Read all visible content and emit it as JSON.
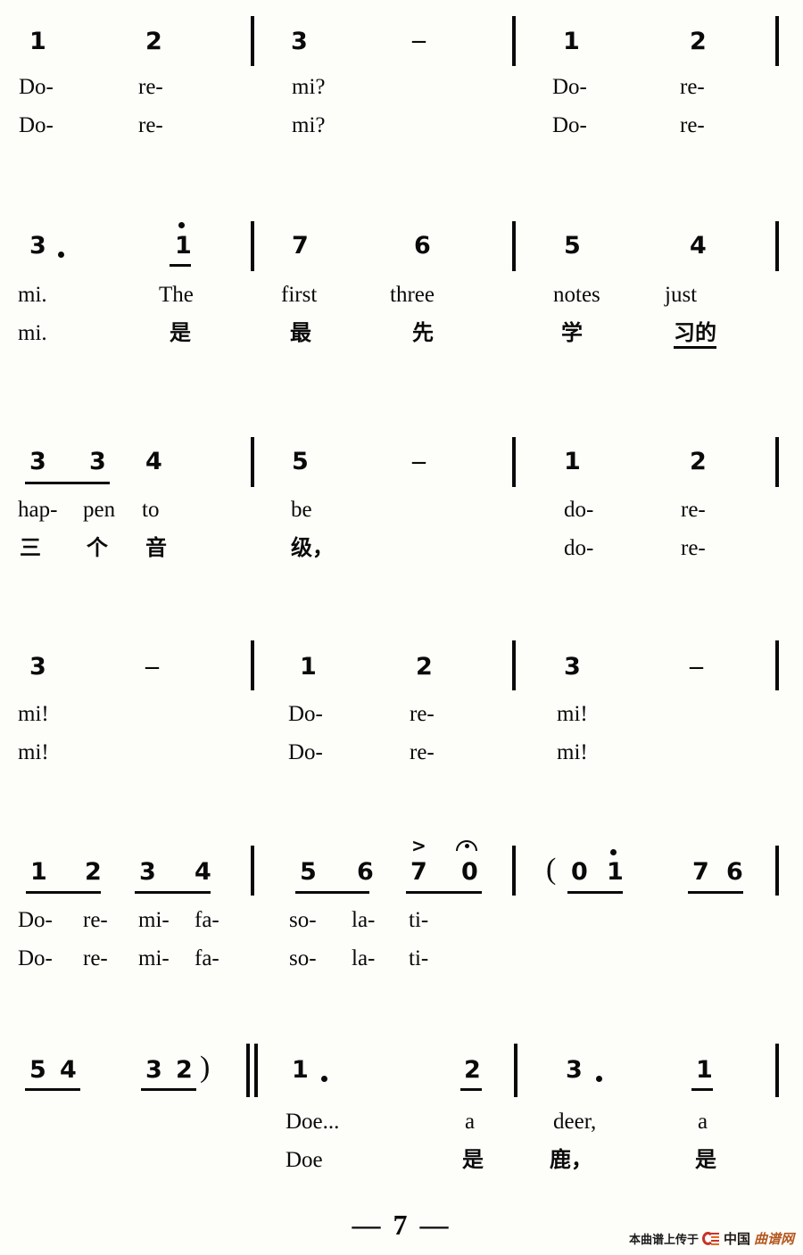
{
  "document": {
    "kind": "jianpu-numbered-musical-notation",
    "title_on_page": "",
    "page_number_label": "— 7 —",
    "page_number": "7"
  },
  "systems": [
    {
      "id": "system-1",
      "notes": [
        "1",
        "2",
        "3",
        "–",
        "1",
        "2"
      ],
      "lyrics_en": [
        "Do-",
        "re-",
        "mi?",
        "Do-",
        "re-"
      ],
      "lyrics_cn": [
        "Do-",
        "re-",
        "mi?",
        "Do-",
        "re-"
      ],
      "barlines": 3
    },
    {
      "id": "system-2",
      "notes": [
        "3",
        "1",
        "7",
        "6",
        "5",
        "4"
      ],
      "note_dots": [
        "3 ·",
        "1 (octave up, beamed)"
      ],
      "lyrics_en": [
        "mi.",
        "The",
        "first",
        "three",
        "notes",
        "just"
      ],
      "lyrics_cn": [
        "mi.",
        "是",
        "最",
        "先",
        "学",
        "习的"
      ],
      "barlines": 3
    },
    {
      "id": "system-3",
      "notes": [
        "3",
        "3",
        "4",
        "5",
        "–",
        "1",
        "2"
      ],
      "lyrics_en": [
        "hap-",
        "pen",
        "to",
        "be",
        "do-",
        "re-"
      ],
      "lyrics_cn": [
        "三",
        "个",
        "音",
        "级，",
        "do-",
        "re-"
      ],
      "barlines": 3
    },
    {
      "id": "system-4",
      "notes": [
        "3",
        "–",
        "1",
        "2",
        "3",
        "–"
      ],
      "lyrics_en": [
        "mi!",
        "Do-",
        "re-",
        "mi!"
      ],
      "lyrics_cn": [
        "mi!",
        "Do-",
        "re-",
        "mi!"
      ],
      "barlines": 3
    },
    {
      "id": "system-5",
      "notes": [
        "1",
        "2",
        "3",
        "4",
        "5",
        "6",
        "7",
        "0",
        "(",
        "0",
        "1",
        "7",
        "6"
      ],
      "marks": [
        "accent > over 7",
        "fermata over 0"
      ],
      "lyrics_en": [
        "Do-",
        "re-",
        "mi-",
        "fa-",
        "so-",
        "la-",
        "ti-"
      ],
      "lyrics_cn": [
        "Do-",
        "re-",
        "mi-",
        "fa-",
        "so-",
        "la-",
        "ti-"
      ],
      "barlines": 2
    },
    {
      "id": "system-6",
      "notes": [
        "5",
        "4",
        "3",
        "2",
        ")",
        "1 ·",
        "2",
        "3 ·",
        "1"
      ],
      "lyrics_en": [
        "Doe...",
        "a",
        "deer,",
        "a"
      ],
      "lyrics_cn": [
        "Doe",
        "是",
        "鹿，",
        "是"
      ],
      "barlines": 3
    }
  ],
  "n1": {
    "a": "1",
    "b": "2",
    "c": "3",
    "d": "–",
    "e": "1",
    "f": "2"
  },
  "l1en": {
    "a": "Do-",
    "b": "re-",
    "c": "mi?",
    "d": "Do-",
    "e": "re-"
  },
  "l1cn": {
    "a": "Do-",
    "b": "re-",
    "c": "mi?",
    "d": "Do-",
    "e": "re-"
  },
  "n2": {
    "a": "3",
    "b": "1",
    "c": "7",
    "d": "6",
    "e": "5",
    "f": "4"
  },
  "l2en": {
    "a": "mi.",
    "b": "The",
    "c": "first",
    "d": "three",
    "e": "notes",
    "f": "just"
  },
  "l2cn": {
    "a": "mi.",
    "b": "是",
    "c": "最",
    "d": "先",
    "e": "学",
    "f": "习的"
  },
  "n3": {
    "a": "3",
    "b": "3",
    "c": "4",
    "d": "5",
    "e": "–",
    "f": "1",
    "g": "2"
  },
  "l3en": {
    "a": "hap-",
    "b": "pen",
    "c": "to",
    "d": "be",
    "e": "do-",
    "f": "re-"
  },
  "l3cn": {
    "a": "三",
    "b": "个",
    "c": "音",
    "d": "级，",
    "e": "do-",
    "f": "re-"
  },
  "n4": {
    "a": "3",
    "b": "–",
    "c": "1",
    "d": "2",
    "e": "3",
    "f": "–"
  },
  "l4en": {
    "a": "mi!",
    "b": "Do-",
    "c": "re-",
    "d": "mi!"
  },
  "l4cn": {
    "a": "mi!",
    "b": "Do-",
    "c": "re-",
    "d": "mi!"
  },
  "n5": {
    "a": "1",
    "b": "2",
    "c": "3",
    "d": "4",
    "e": "5",
    "f": "6",
    "g": "7",
    "h": "0",
    "paren": "(",
    "i": "0",
    "j": "1",
    "k": "7",
    "l": "6",
    "accent": ">"
  },
  "l5en": {
    "a": "Do-",
    "b": "re-",
    "c": "mi-",
    "d": "fa-",
    "e": "so-",
    "f": "la-",
    "g": "ti-"
  },
  "l5cn": {
    "a": "Do-",
    "b": "re-",
    "c": "mi-",
    "d": "fa-",
    "e": "so-",
    "f": "la-",
    "g": "ti-"
  },
  "n6": {
    "a": "5",
    "b": "4",
    "c": "3",
    "d": "2",
    "paren": ")",
    "e": "1",
    "f": "2",
    "g": "3",
    "h": "1"
  },
  "l6en": {
    "a": "Doe...",
    "b": "a",
    "c": "deer,",
    "d": "a"
  },
  "l6cn": {
    "a": "Doe",
    "b": "是",
    "c": "鹿，",
    "d": "是"
  },
  "footer": {
    "page_number": "— 7 —",
    "watermark_prefix": "本曲谱上传于",
    "watermark_brand_dark": "中国",
    "watermark_brand_accent": "曲谱网",
    "accent_color": "#b4581f",
    "logo_color": "#c8322a"
  }
}
